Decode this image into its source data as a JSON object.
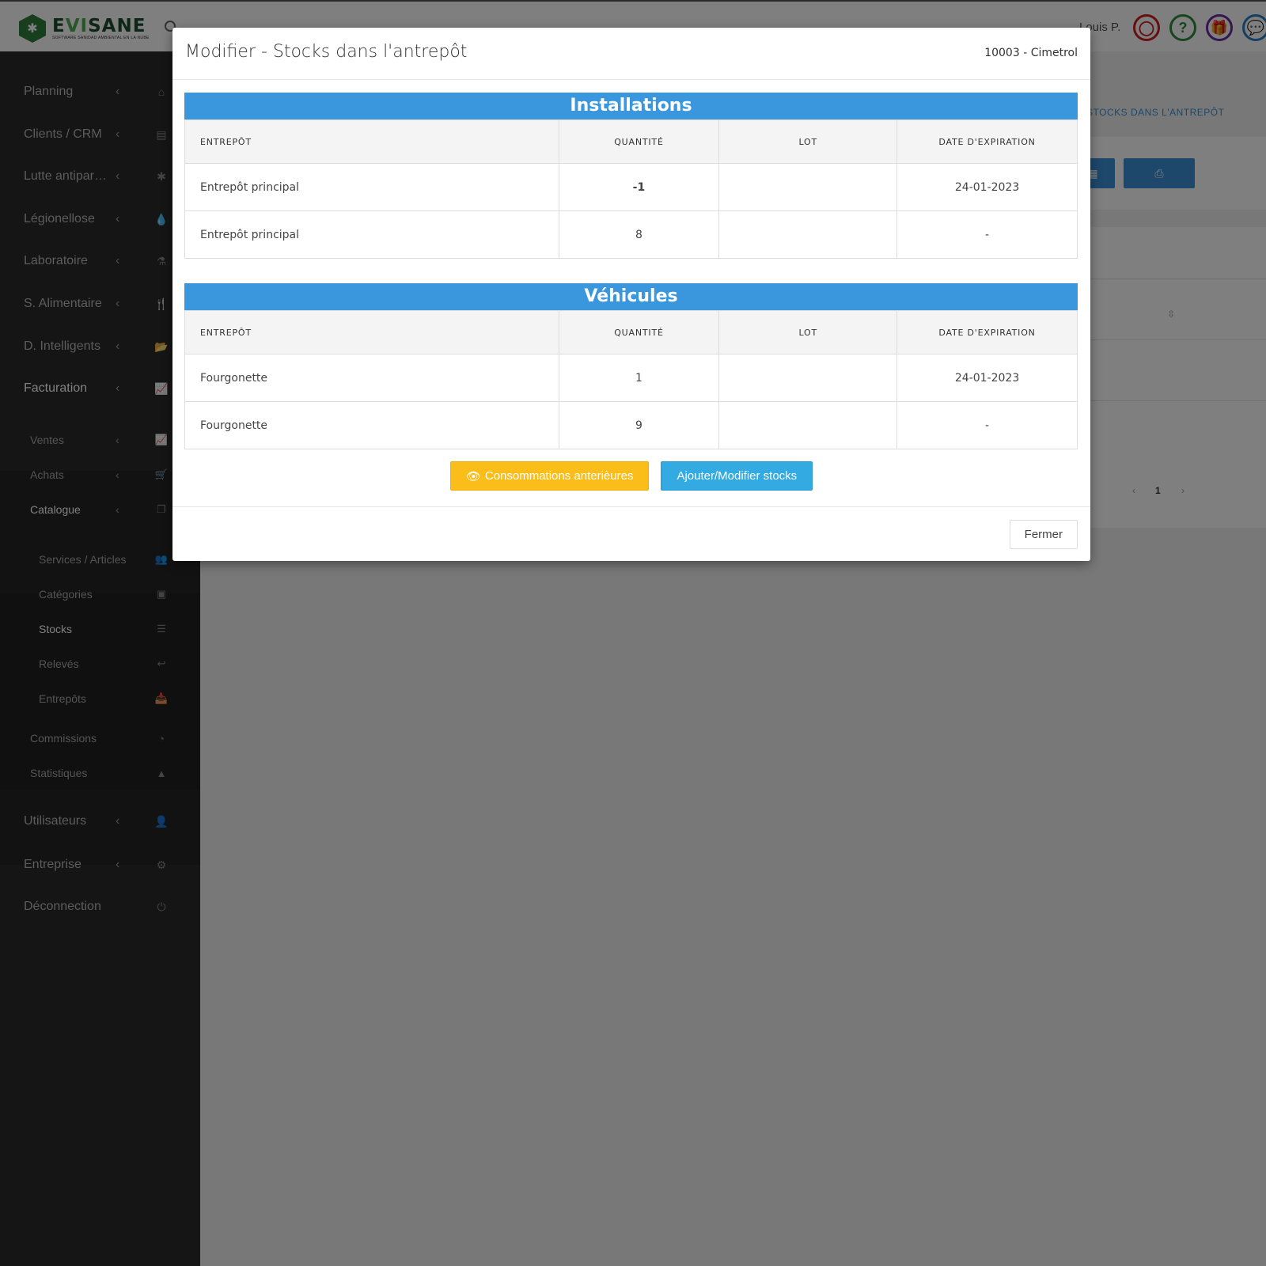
{
  "app": {
    "logo_text_a": "E",
    "logo_text_b": "VI",
    "logo_text_c": "SANE",
    "logo_tagline": "SOFTWARE SANIDAD AMBIENTAL EN LA NUBE",
    "user_name": "Louis P."
  },
  "topbar_icons": [
    {
      "name": "avatar-icon",
      "glyph": "◯",
      "color": "#cc1f1f"
    },
    {
      "name": "help-icon",
      "glyph": "?",
      "color": "#2e8b3a"
    },
    {
      "name": "gift-icon",
      "glyph": "🎁",
      "color": "#6b2ca0"
    },
    {
      "name": "chat-icon",
      "glyph": "💬",
      "color": "#2a7fc1"
    }
  ],
  "sidebar": {
    "items": [
      {
        "label": "Planning",
        "icon": "home-icon",
        "glyph": "⌂"
      },
      {
        "label": "Clients / CRM",
        "icon": "address-card-icon",
        "glyph": "▤"
      },
      {
        "label": "Lutte antipar…",
        "icon": "bug-icon",
        "glyph": "✱"
      },
      {
        "label": "Légionellose",
        "icon": "drop-icon",
        "glyph": "💧"
      },
      {
        "label": "Laboratoire",
        "icon": "flask-icon",
        "glyph": "⚗"
      },
      {
        "label": "S. Alimentaire",
        "icon": "cutlery-icon",
        "glyph": "🍴"
      },
      {
        "label": "D. Intelligents",
        "icon": "folder-open-icon",
        "glyph": "📂"
      },
      {
        "label": "Facturation",
        "icon": "line-chart-icon",
        "glyph": "📈"
      }
    ],
    "facturation_sub": [
      {
        "label": "Ventes",
        "icon": "line-chart-icon",
        "glyph": "📈",
        "chev": true
      },
      {
        "label": "Achats",
        "icon": "cart-icon",
        "glyph": "🛒",
        "chev": true
      },
      {
        "label": "Catalogue",
        "icon": "copy-icon",
        "glyph": "❐",
        "chev": true
      }
    ],
    "catalogue_sub": [
      {
        "label": "Services / Articles",
        "icon": "users-icon",
        "glyph": "👥"
      },
      {
        "label": "Catégories",
        "icon": "archive-icon",
        "glyph": "▣"
      },
      {
        "label": "Stocks",
        "icon": "list-icon",
        "glyph": "☰"
      },
      {
        "label": "Relevés",
        "icon": "reply-icon",
        "glyph": "↩"
      },
      {
        "label": "Entrepôts",
        "icon": "inbox-icon",
        "glyph": "📥"
      }
    ],
    "facturation_tail": [
      {
        "label": "Commissions",
        "icon": "pie-chart-icon",
        "glyph": "◔"
      },
      {
        "label": "Statistiques",
        "icon": "area-chart-icon",
        "glyph": "▲"
      }
    ],
    "bottom_items": [
      {
        "label": "Utilisateurs",
        "icon": "user-icon",
        "glyph": "👤",
        "chev": true
      },
      {
        "label": "Entreprise",
        "icon": "gear-icon",
        "glyph": "⚙",
        "chev": true
      },
      {
        "label": "Déconnection",
        "icon": "power-icon",
        "glyph": "⏻",
        "chev": false
      }
    ]
  },
  "background": {
    "breadcrumb": "STOCKS DANS L'ANTREPÔT",
    "excel_glyph": "▦",
    "print_glyph": "⎙",
    "pager_prev": "‹",
    "pager_page": "1",
    "pager_next": "›",
    "sort_glyph": "⇳"
  },
  "modal": {
    "title": "Modifier - Stocks dans l'antrepôt",
    "subtitle": "10003 - Cimetrol",
    "columns": [
      "ENTREPÔT",
      "QUANTITÉ",
      "LOT",
      "DATE D'EXPIRATION"
    ],
    "installations": {
      "title": "Installations",
      "rows": [
        {
          "entrepot": "Entrepôt principal",
          "quantite": "-1",
          "lot": "",
          "date": "24-01-2023"
        },
        {
          "entrepot": "Entrepôt principal",
          "quantite": "8",
          "lot": "",
          "date": "-"
        }
      ]
    },
    "vehicules": {
      "title": "Véhicules",
      "rows": [
        {
          "entrepot": "Fourgonette",
          "quantite": "1",
          "lot": "",
          "date": "24-01-2023"
        },
        {
          "entrepot": "Fourgonette",
          "quantite": "9",
          "lot": "",
          "date": "-"
        }
      ]
    },
    "btn_consommations": "Consommations anterièures",
    "btn_ajouter": "Ajouter/Modifier stocks",
    "btn_fermer": "Fermer"
  },
  "colors": {
    "banner": "#3a97dd",
    "warning": "#fbbd19",
    "info": "#34aae3",
    "negative_qty": "#e02020",
    "low_qty": "#f5a623",
    "sidebar_bg": "#2a2a2a"
  }
}
